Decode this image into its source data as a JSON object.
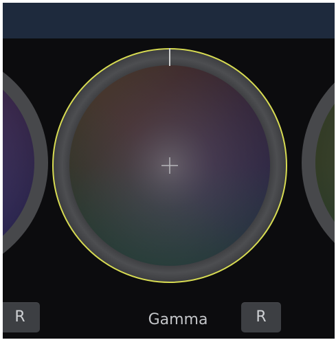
{
  "wheels": {
    "center": {
      "label": "Gamma",
      "reset_label": "R",
      "selected_outline_color": "#d8dc52"
    },
    "left": {
      "reset_label": "R"
    }
  },
  "colors": {
    "panel_background": "#0c0c0e",
    "header_bar": "#1e2a3d",
    "ring": "#47484b",
    "button": "#3d3f43",
    "label_text": "#c4c6c9"
  },
  "icons": {
    "crosshair": "crosshair-icon",
    "indicator": "rotation-indicator-icon"
  }
}
